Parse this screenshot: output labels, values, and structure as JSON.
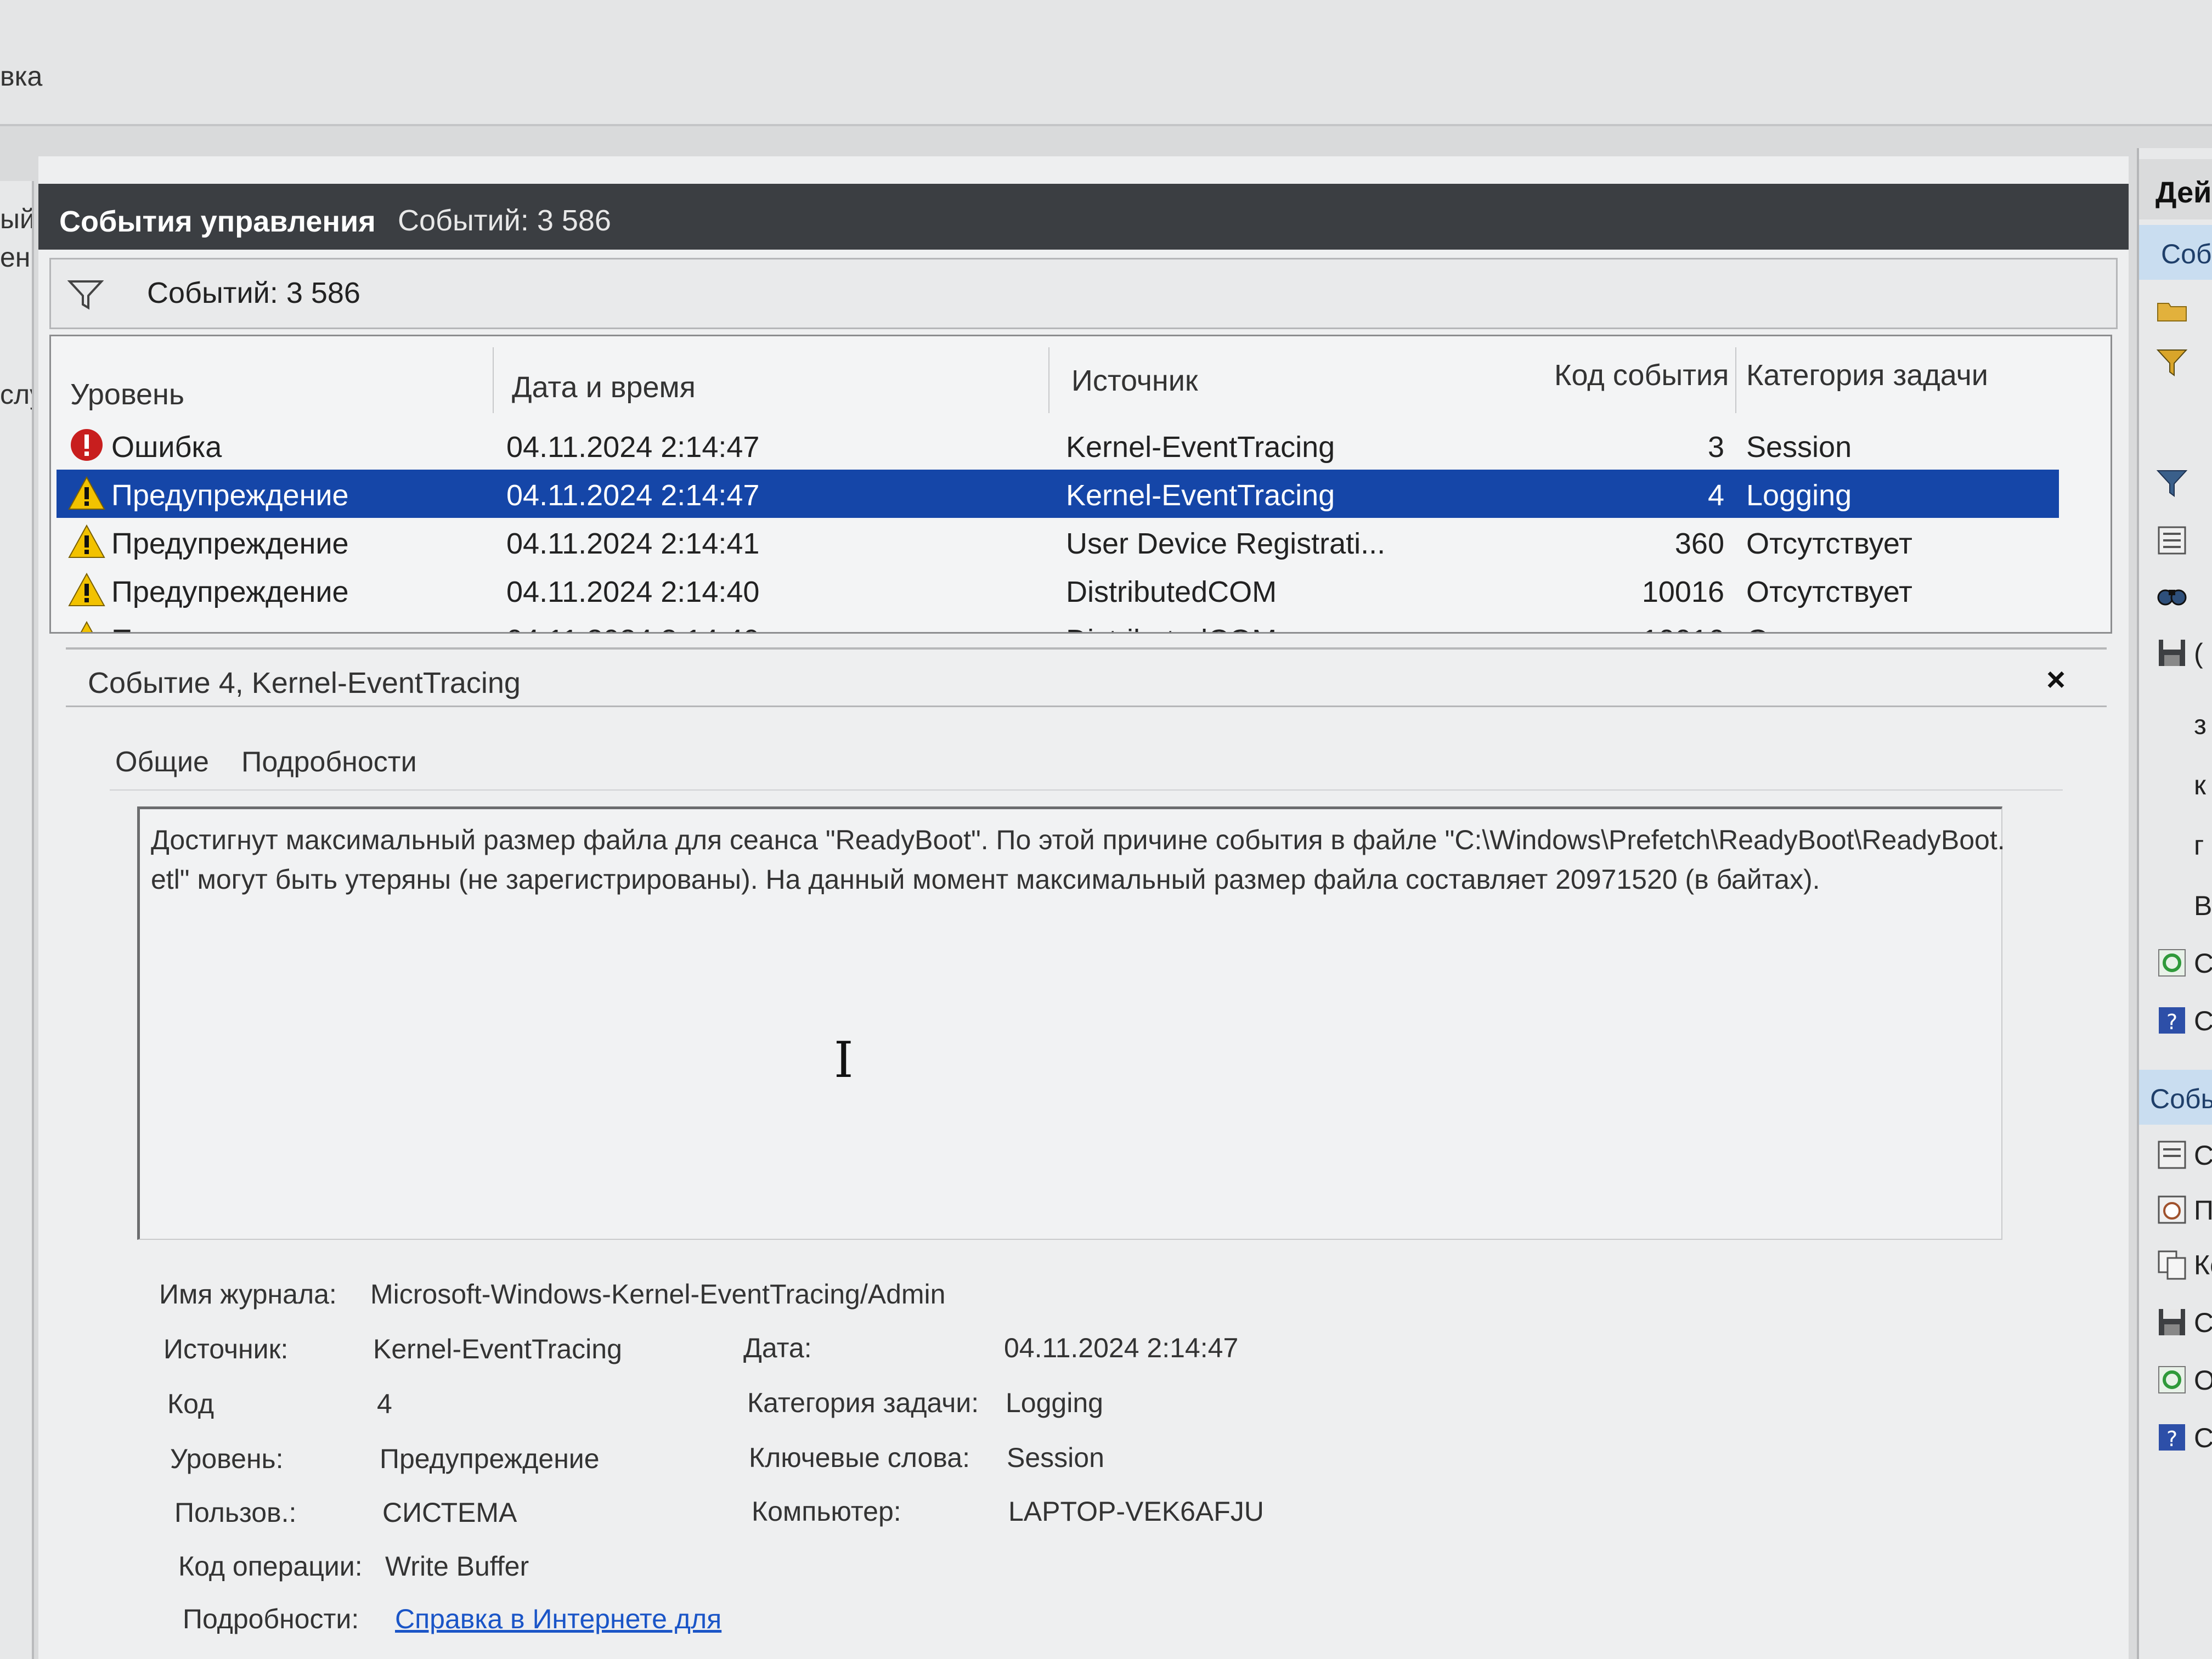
{
  "menubar": {
    "fragment": "вка"
  },
  "left_pane": {
    "fragments": [
      "ый",
      "ен",
      "слу"
    ]
  },
  "header": {
    "title": "События управления",
    "count": "Событий: 3 586"
  },
  "filter": {
    "count": "Событий: 3 586"
  },
  "grid": {
    "columns": [
      "Уровень",
      "Дата и время",
      "Источник",
      "Код события",
      "Категория задачи"
    ],
    "rows": [
      {
        "level": "Ошибка",
        "level_icon": "error-icon",
        "datetime": "04.11.2024 2:14:47",
        "source": "Kernel-EventTracing",
        "code": "3",
        "category": "Session",
        "selected": false
      },
      {
        "level": "Предупреждение",
        "level_icon": "warning-icon",
        "datetime": "04.11.2024 2:14:47",
        "source": "Kernel-EventTracing",
        "code": "4",
        "category": "Logging",
        "selected": true
      },
      {
        "level": "Предупреждение",
        "level_icon": "warning-icon",
        "datetime": "04.11.2024 2:14:41",
        "source": "User Device Registrati...",
        "code": "360",
        "category": "Отсутствует",
        "selected": false
      },
      {
        "level": "Предупреждение",
        "level_icon": "warning-icon",
        "datetime": "04.11.2024 2:14:40",
        "source": "DistributedCOM",
        "code": "10016",
        "category": "Отсутствует",
        "selected": false
      },
      {
        "level": "Предупреждение",
        "level_icon": "warning-icon",
        "datetime": "04.11.2024 2:14:40",
        "source": "DistributedCOM",
        "code": "10016",
        "category": "Отсутствует",
        "selected": false
      }
    ]
  },
  "details": {
    "title": "Событие 4, Kernel-EventTracing",
    "close": "×",
    "tabs": [
      "Общие",
      "Подробности"
    ],
    "description": "Достигнут максимальный размер файла для сеанса \"ReadyBoot\". По этой причине события в файле \"C:\\Windows\\Prefetch\\ReadyBoot\\ReadyBoot.etl\" могут быть утеряны (не зарегистрированы). На данный момент максимальный размер файла составляет 20971520 (в байтах).",
    "log_name_label": "Имя журнала:",
    "log_name": "Microsoft-Windows-Kernel-EventTracing/Admin",
    "source_label": "Источник:",
    "source": "Kernel-EventTracing",
    "date_label": "Дата:",
    "date": "04.11.2024 2:14:47",
    "code_label": "Код",
    "code": "4",
    "task_category_label": "Категория задачи:",
    "task_category": "Logging",
    "level_label": "Уровень:",
    "level": "Предупреждение",
    "keywords_label": "Ключевые слова:",
    "keywords": "Session",
    "user_label": "Пользов.:",
    "user": "СИСТЕМА",
    "computer_label": "Компьютер:",
    "computer": "LAPTOP-VEK6AFJU",
    "opcode_label": "Код операции:",
    "opcode": "Write Buffer",
    "more_label": "Подробности:",
    "more_link": "Справка в Интернете для"
  },
  "actions": {
    "header": "Дей",
    "section1": "Соб",
    "section2": "Событ",
    "items_top": [
      {
        "icon": "open-folder-icon",
        "label": ""
      },
      {
        "icon": "filter-icon",
        "label": ""
      },
      {
        "icon": "clear-filter-icon",
        "label": ""
      },
      {
        "icon": "properties-icon",
        "label": ""
      },
      {
        "icon": "find-icon",
        "label": ""
      },
      {
        "icon": "save-icon",
        "label": "("
      },
      {
        "icon": "",
        "label": "з"
      },
      {
        "icon": "",
        "label": "к"
      },
      {
        "icon": "",
        "label": "г"
      },
      {
        "icon": "",
        "label": "В"
      },
      {
        "icon": "refresh-icon",
        "label": "С"
      },
      {
        "icon": "help-icon",
        "label": "С"
      }
    ],
    "items_bottom": [
      {
        "icon": "event-properties-icon",
        "label": "Св"
      },
      {
        "icon": "attach-task-icon",
        "label": "Пр"
      },
      {
        "icon": "copy-icon",
        "label": "Ко"
      },
      {
        "icon": "save-icon",
        "label": "Со"
      },
      {
        "icon": "refresh-icon",
        "label": "Об"
      },
      {
        "icon": "help-icon",
        "label": "Сп"
      }
    ]
  },
  "colors": {
    "selection": "#1546a8",
    "header": "#3b3e42",
    "link": "#1a55c7",
    "error": "#c81e1e",
    "warning": "#f2c200"
  }
}
